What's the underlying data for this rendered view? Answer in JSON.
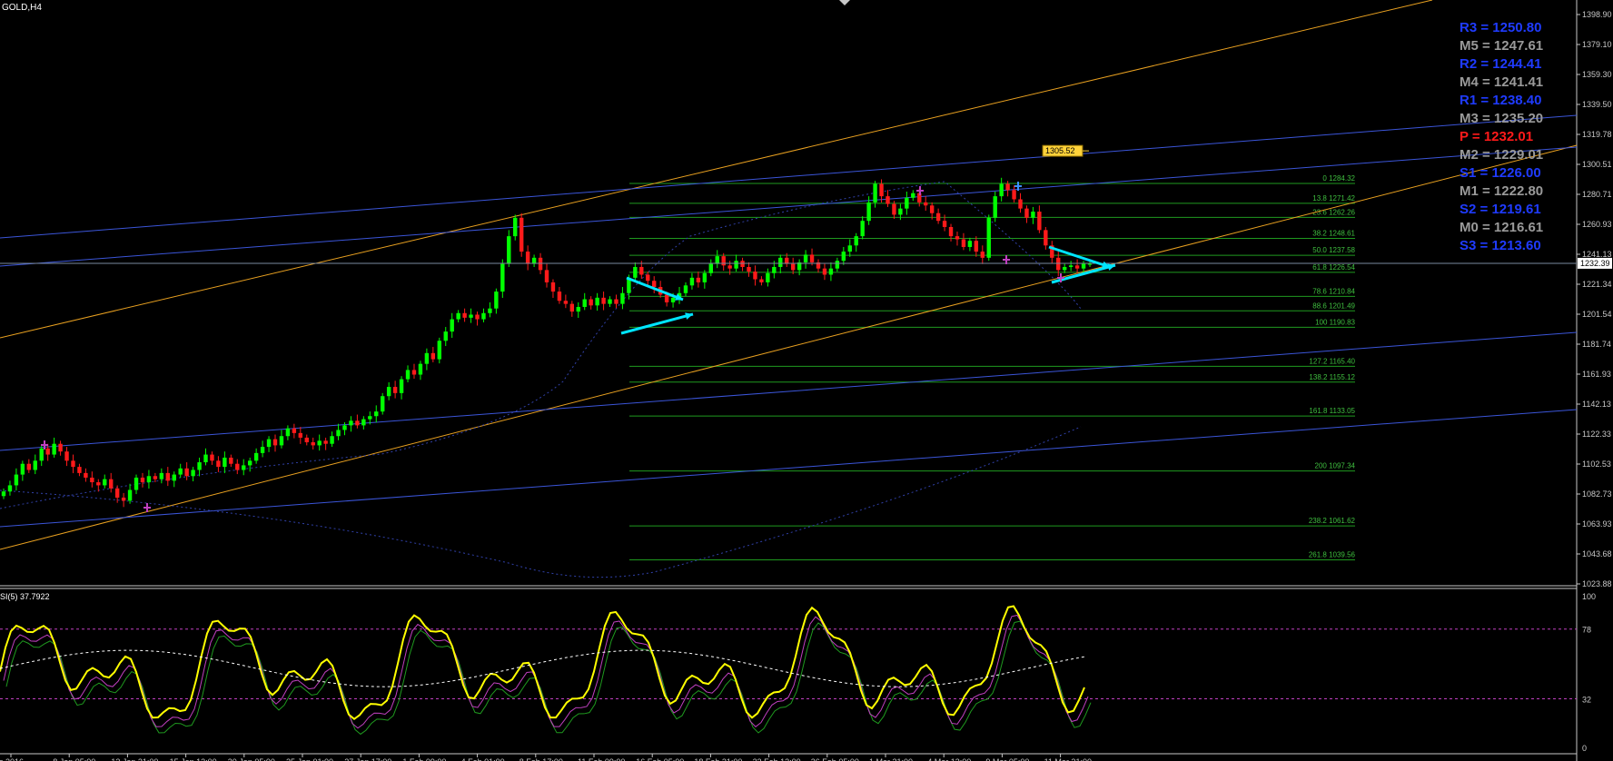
{
  "symbol_title": "GOLD,H4",
  "current_price_label": "1232.39",
  "price_axis": {
    "ticks": [
      "1398.90",
      "1379.10",
      "1359.30",
      "1339.50",
      "1319.78",
      "1300.51",
      "1280.71",
      "1260.93",
      "1241.13",
      "1221.34",
      "1201.54",
      "1181.74",
      "1161.93",
      "1142.13",
      "1122.33",
      "1102.53",
      "1082.73",
      "1063.93",
      "1043.68",
      "1023.88"
    ]
  },
  "pivot_levels": [
    {
      "label": "R3 = 1250.80",
      "color": "#1f3bff"
    },
    {
      "label": "M5 = 1247.61",
      "color": "#9a9a9a"
    },
    {
      "label": "R2 = 1244.41",
      "color": "#1f3bff"
    },
    {
      "label": "M4 = 1241.41",
      "color": "#9a9a9a"
    },
    {
      "label": "R1 = 1238.40",
      "color": "#1f3bff"
    },
    {
      "label": "M3 = 1235.20",
      "color": "#9a9a9a"
    },
    {
      "label": "P   = 1232.01",
      "color": "#ff1a1a"
    },
    {
      "label": "M2 = 1229.01",
      "color": "#9a9a9a"
    },
    {
      "label": "S1 = 1226.00",
      "color": "#1f3bff"
    },
    {
      "label": "M1 = 1222.80",
      "color": "#9a9a9a"
    },
    {
      "label": "S2 = 1219.61",
      "color": "#1f3bff"
    },
    {
      "label": "M0 = 1216.61",
      "color": "#9a9a9a"
    },
    {
      "label": "S3 = 1213.60",
      "color": "#1f3bff"
    }
  ],
  "fib_levels": [
    {
      "label": "0 1284.32",
      "value": 1284.32
    },
    {
      "label": "13.8 1271.42",
      "value": 1271.42
    },
    {
      "label": "23.6 1262.26",
      "value": 1262.26
    },
    {
      "label": "38.2 1248.61",
      "value": 1248.61
    },
    {
      "label": "50.0 1237.58",
      "value": 1237.58
    },
    {
      "label": "61.8 1226.54",
      "value": 1226.54
    },
    {
      "label": "78.6 1210.84",
      "value": 1210.84
    },
    {
      "label": "88.6 1201.49",
      "value": 1201.49
    },
    {
      "label": "100 1190.83",
      "value": 1190.83
    },
    {
      "label": "127.2 1165.40",
      "value": 1165.4
    },
    {
      "label": "138.2 1155.12",
      "value": 1155.12
    },
    {
      "label": "161.8 1133.05",
      "value": 1133.05
    },
    {
      "label": "200 1097.34",
      "value": 1097.34
    },
    {
      "label": "238.2 1061.62",
      "value": 1061.62
    },
    {
      "label": "261.8 1039.56",
      "value": 1039.56
    }
  ],
  "target_label": "1305.52",
  "oscillator": {
    "title": "SI(5) 37.7922",
    "axis_labels": [
      "100",
      "78",
      "32",
      "0"
    ],
    "upper_level": 78,
    "lower_level": 32
  },
  "time_axis": {
    "labels": [
      "ec 2016",
      "8 Jan 05:00",
      "13 Jan 21:00",
      "15 Jan 13:00",
      "20 Jan 05:00",
      "25 Jan 01:00",
      "27 Jan 17:00",
      "1 Feb 09:00",
      "4 Feb 01:00",
      "8 Feb 17:00",
      "11 Feb 09:00",
      "16 Feb 05:00",
      "18 Feb 21:00",
      "23 Feb 13:00",
      "26 Feb 05:00",
      "1 Mar 21:00",
      "4 Mar 13:00",
      "9 Mar 05:00",
      "11 Mar 21:00"
    ]
  },
  "colors": {
    "background": "#000000",
    "bull_candle": "#00ff00",
    "bear_candle": "#ff1a1a",
    "fib_line": "#1f9a1f",
    "channel_orange": "#e8a020",
    "channel_blue": "#3b55d8",
    "arrow": "#00e5ff",
    "osc_main": "#ffff00",
    "osc_signal": "#ffffff",
    "axis_text": "#c8c8c8"
  },
  "chart_data": {
    "type": "candlestick",
    "title": "GOLD,H4",
    "ylim": [
      1023.88,
      1398.9
    ],
    "close": [
      1084,
      1088,
      1095,
      1102,
      1098,
      1104,
      1112,
      1108,
      1115,
      1110,
      1104,
      1100,
      1096,
      1093,
      1090,
      1088,
      1092,
      1086,
      1080,
      1078,
      1085,
      1093,
      1090,
      1094,
      1092,
      1096,
      1091,
      1095,
      1099,
      1094,
      1098,
      1103,
      1108,
      1104,
      1100,
      1106,
      1102,
      1098,
      1101,
      1104,
      1109,
      1113,
      1118,
      1114,
      1120,
      1125,
      1122,
      1119,
      1116,
      1114,
      1117,
      1115,
      1120,
      1124,
      1127,
      1130,
      1127,
      1131,
      1133,
      1136,
      1146,
      1152,
      1148,
      1157,
      1163,
      1160,
      1167,
      1174,
      1170,
      1182,
      1188,
      1196,
      1200,
      1197,
      1199,
      1196,
      1200,
      1203,
      1214,
      1232,
      1250,
      1262,
      1240,
      1232,
      1236,
      1228,
      1220,
      1214,
      1208,
      1206,
      1201,
      1204,
      1209,
      1205,
      1210,
      1206,
      1209,
      1206,
      1213,
      1223,
      1230,
      1225,
      1221,
      1217,
      1212,
      1207,
      1210,
      1213,
      1218,
      1223,
      1220,
      1226,
      1232,
      1237,
      1231,
      1229,
      1234,
      1230,
      1227,
      1222,
      1220,
      1226,
      1230,
      1236,
      1232,
      1228,
      1233,
      1238,
      1233,
      1229,
      1225,
      1229,
      1234,
      1240,
      1244,
      1250,
      1260,
      1272,
      1284,
      1276,
      1271,
      1264,
      1268,
      1275,
      1278,
      1272,
      1270,
      1265,
      1260,
      1256,
      1250,
      1248,
      1243,
      1247,
      1240,
      1236,
      1262,
      1276,
      1284,
      1280,
      1274,
      1268,
      1262,
      1266,
      1254,
      1244,
      1236,
      1228,
      1230,
      1231,
      1229,
      1232,
      1232
    ]
  }
}
